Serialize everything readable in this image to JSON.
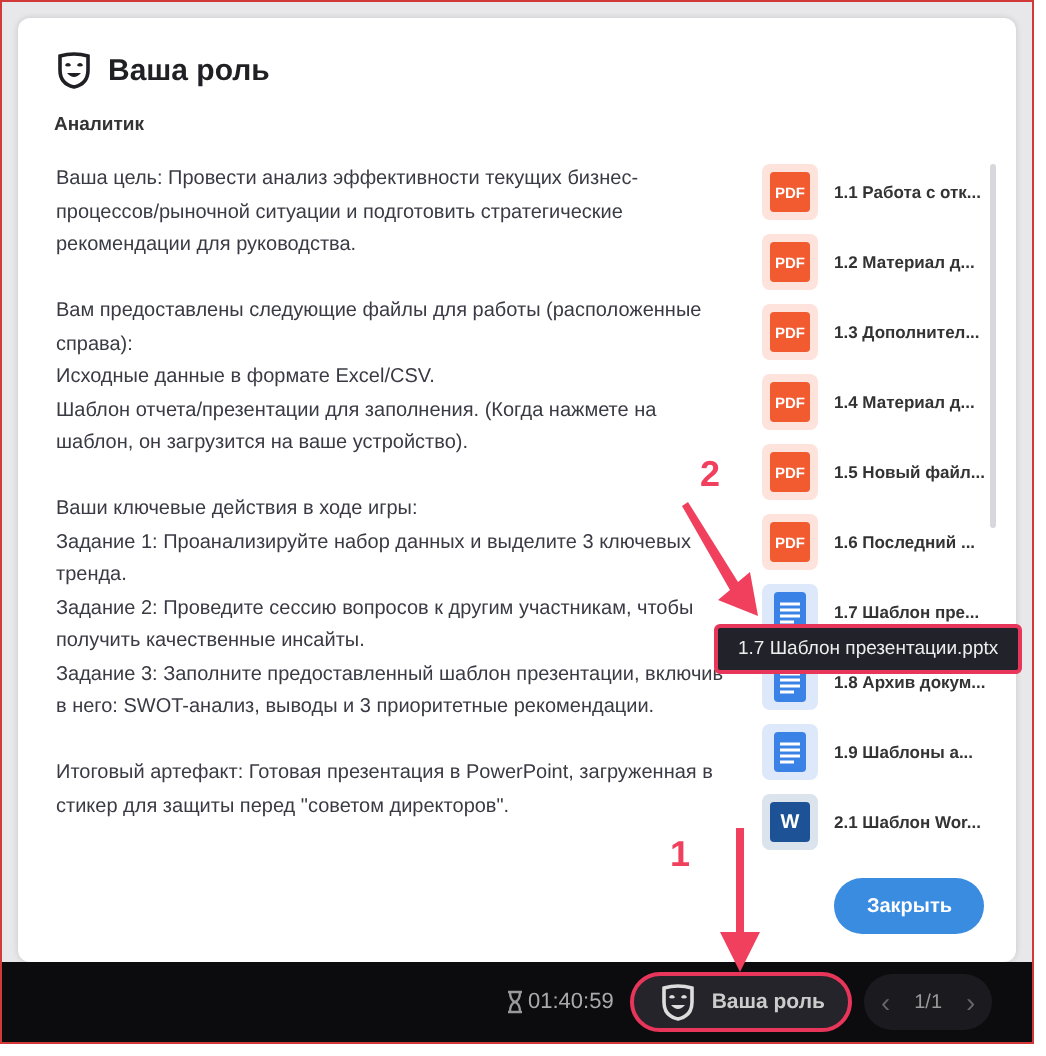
{
  "dialog": {
    "title": "Ваша роль",
    "role": "Аналитик",
    "description": [
      [
        "Ваша цель: Провести анализ эффективности текущих бизнес-процессов/рыночной ситуации и подготовить стратегические рекомендации для руководства."
      ],
      [
        "Вам предоставлены следующие файлы для работы (расположенные справа):",
        "Исходные данные в формате Excel/CSV.",
        "Шаблон отчета/презентации для заполнения. (Когда нажмете на шаблон, он загрузится на ваше устройство)."
      ],
      [
        "Ваши ключевые действия в ходе игры:",
        "Задание 1: Проанализируйте набор данных и выделите 3 ключевых тренда.",
        "Задание 2: Проведите сессию вопросов к другим участникам, чтобы получить качественные инсайты.",
        "Задание 3: Заполните предоставленный шаблон презентации, включив в него: SWOT-анализ, выводы и 3 приоритетные рекомендации."
      ],
      [
        "Итоговый артефакт: Готовая презентация в PowerPoint, загруженная в стикер для защиты перед \"советом директоров\"."
      ]
    ],
    "files": [
      {
        "kind": "pdf",
        "icon_text": "PDF",
        "name": "1.1 Работа с отк..."
      },
      {
        "kind": "pdf",
        "icon_text": "PDF",
        "name": "1.2 Материал д..."
      },
      {
        "kind": "pdf",
        "icon_text": "PDF",
        "name": "1.3 Дополнител..."
      },
      {
        "kind": "pdf",
        "icon_text": "PDF",
        "name": "1.4 Материал д..."
      },
      {
        "kind": "pdf",
        "icon_text": "PDF",
        "name": "1.5 Новый файл..."
      },
      {
        "kind": "pdf",
        "icon_text": "PDF",
        "name": "1.6 Последний ..."
      },
      {
        "kind": "doc",
        "name": "1.7 Шаблон пре..."
      },
      {
        "kind": "doc",
        "name": "1.8 Архив докум..."
      },
      {
        "kind": "doc",
        "name": "1.9 Шаблоны а..."
      },
      {
        "kind": "word",
        "icon_text": "W",
        "name": "2.1 Шаблон Wor..."
      }
    ],
    "tooltip": "1.7 Шаблон презентации.pptx",
    "close_button": "Закрыть"
  },
  "bottom_bar": {
    "timer": "01:40:59",
    "role_button": "Ваша роль",
    "pager": {
      "prev": "‹",
      "page": "1/1",
      "next": "›"
    }
  },
  "annotations": [
    {
      "label": "1"
    },
    {
      "label": "2"
    }
  ]
}
